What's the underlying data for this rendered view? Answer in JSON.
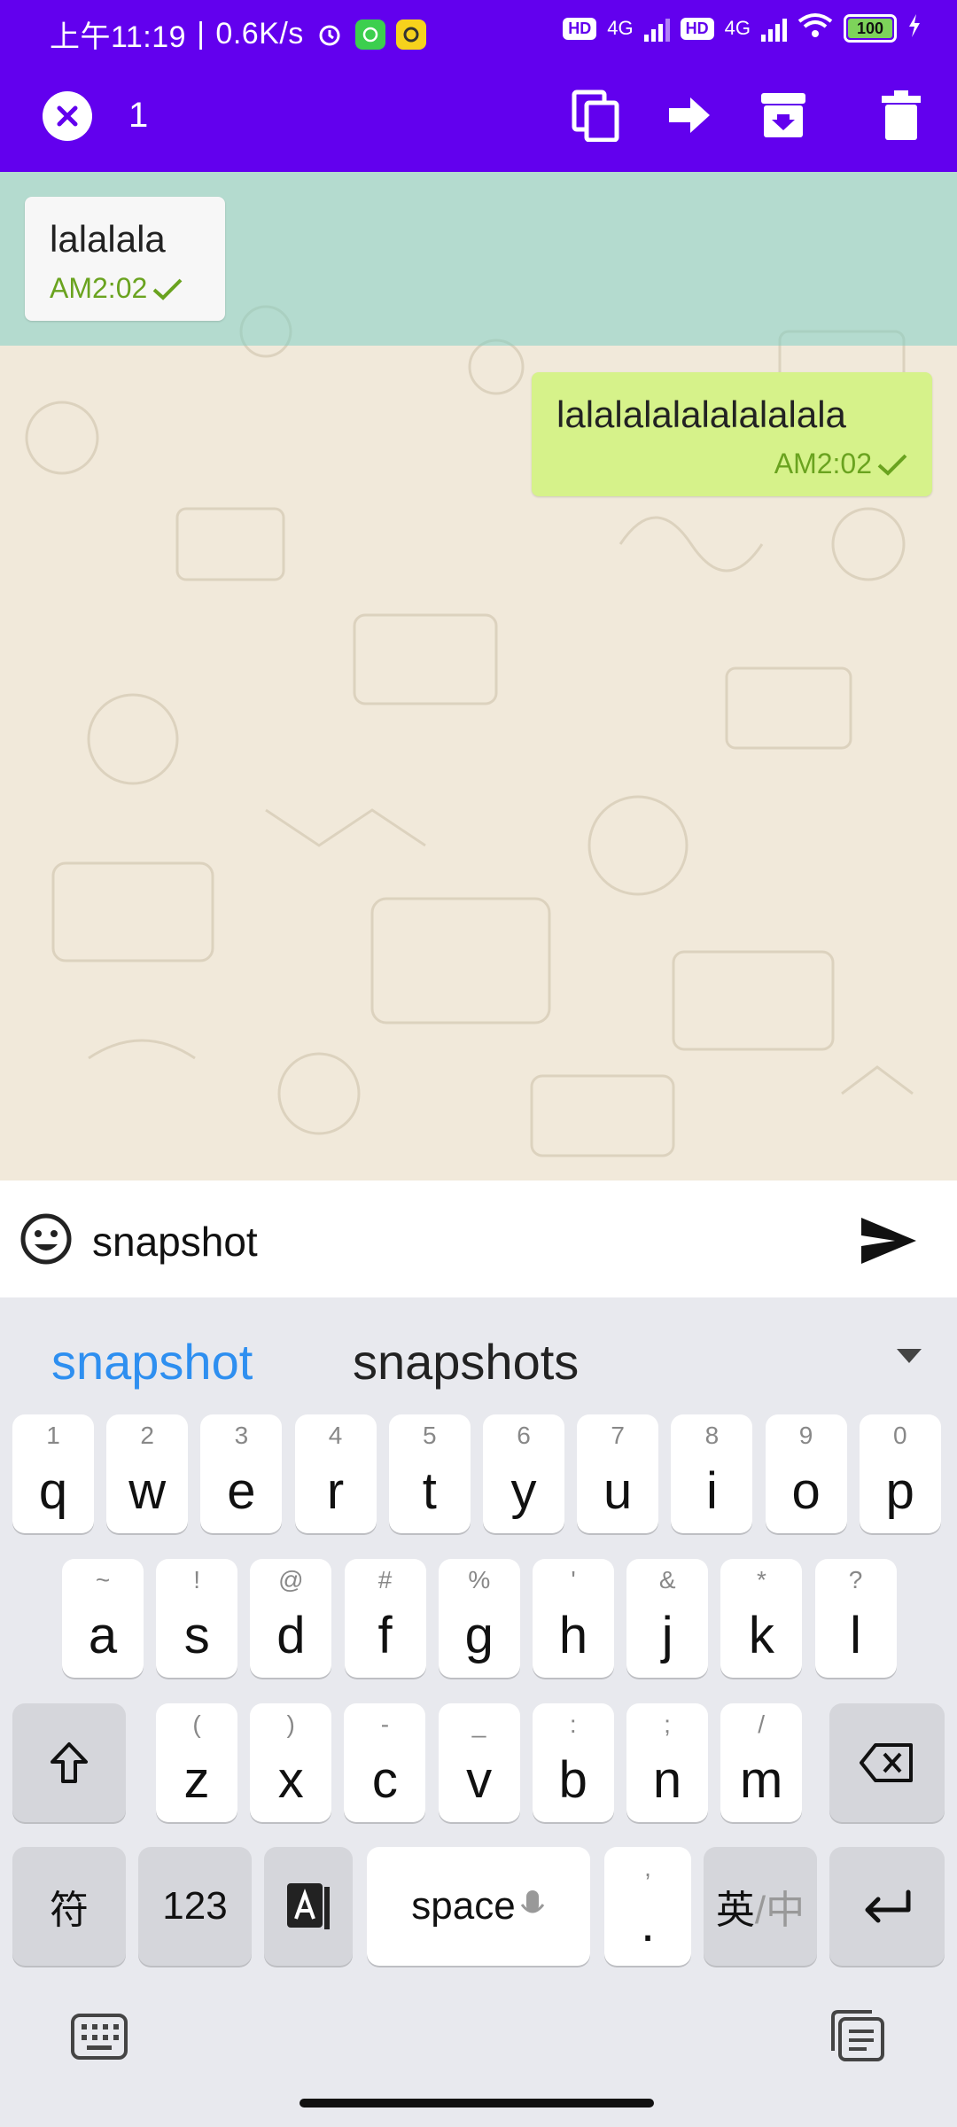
{
  "status": {
    "time": "上午11:19",
    "speed": "0.6K/s",
    "network1": "4G",
    "network2": "4G",
    "hd": "HD",
    "battery": "100"
  },
  "action_bar": {
    "selected_count": "1",
    "accent": "#6200ee"
  },
  "messages": [
    {
      "direction": "in",
      "text": "lalalala",
      "time": "AM2:02",
      "status": "sent-check"
    },
    {
      "direction": "out",
      "text": "lalalalalalalalalala",
      "time": "AM2:02",
      "status": "sent-check"
    }
  ],
  "composer": {
    "value": "snapshot"
  },
  "keyboard": {
    "suggestions": [
      "snapshot",
      "snapshots"
    ],
    "row1": [
      {
        "main": "q",
        "hint": "1"
      },
      {
        "main": "w",
        "hint": "2"
      },
      {
        "main": "e",
        "hint": "3"
      },
      {
        "main": "r",
        "hint": "4"
      },
      {
        "main": "t",
        "hint": "5"
      },
      {
        "main": "y",
        "hint": "6"
      },
      {
        "main": "u",
        "hint": "7"
      },
      {
        "main": "i",
        "hint": "8"
      },
      {
        "main": "o",
        "hint": "9"
      },
      {
        "main": "p",
        "hint": "0"
      }
    ],
    "row2": [
      {
        "main": "a",
        "hint": "~"
      },
      {
        "main": "s",
        "hint": "!"
      },
      {
        "main": "d",
        "hint": "@"
      },
      {
        "main": "f",
        "hint": "#"
      },
      {
        "main": "g",
        "hint": "%"
      },
      {
        "main": "h",
        "hint": "'"
      },
      {
        "main": "j",
        "hint": "&"
      },
      {
        "main": "k",
        "hint": "*"
      },
      {
        "main": "l",
        "hint": "?"
      }
    ],
    "row3": [
      {
        "main": "z",
        "hint": "("
      },
      {
        "main": "x",
        "hint": ")"
      },
      {
        "main": "c",
        "hint": "-"
      },
      {
        "main": "v",
        "hint": "_"
      },
      {
        "main": "b",
        "hint": ":"
      },
      {
        "main": "n",
        "hint": ";"
      },
      {
        "main": "m",
        "hint": "/"
      }
    ],
    "symbols_label": "符",
    "numbers_label": "123",
    "space_label": "space",
    "period_label": ".",
    "period_hint": ",",
    "lang_primary": "英",
    "lang_secondary": "/中"
  }
}
